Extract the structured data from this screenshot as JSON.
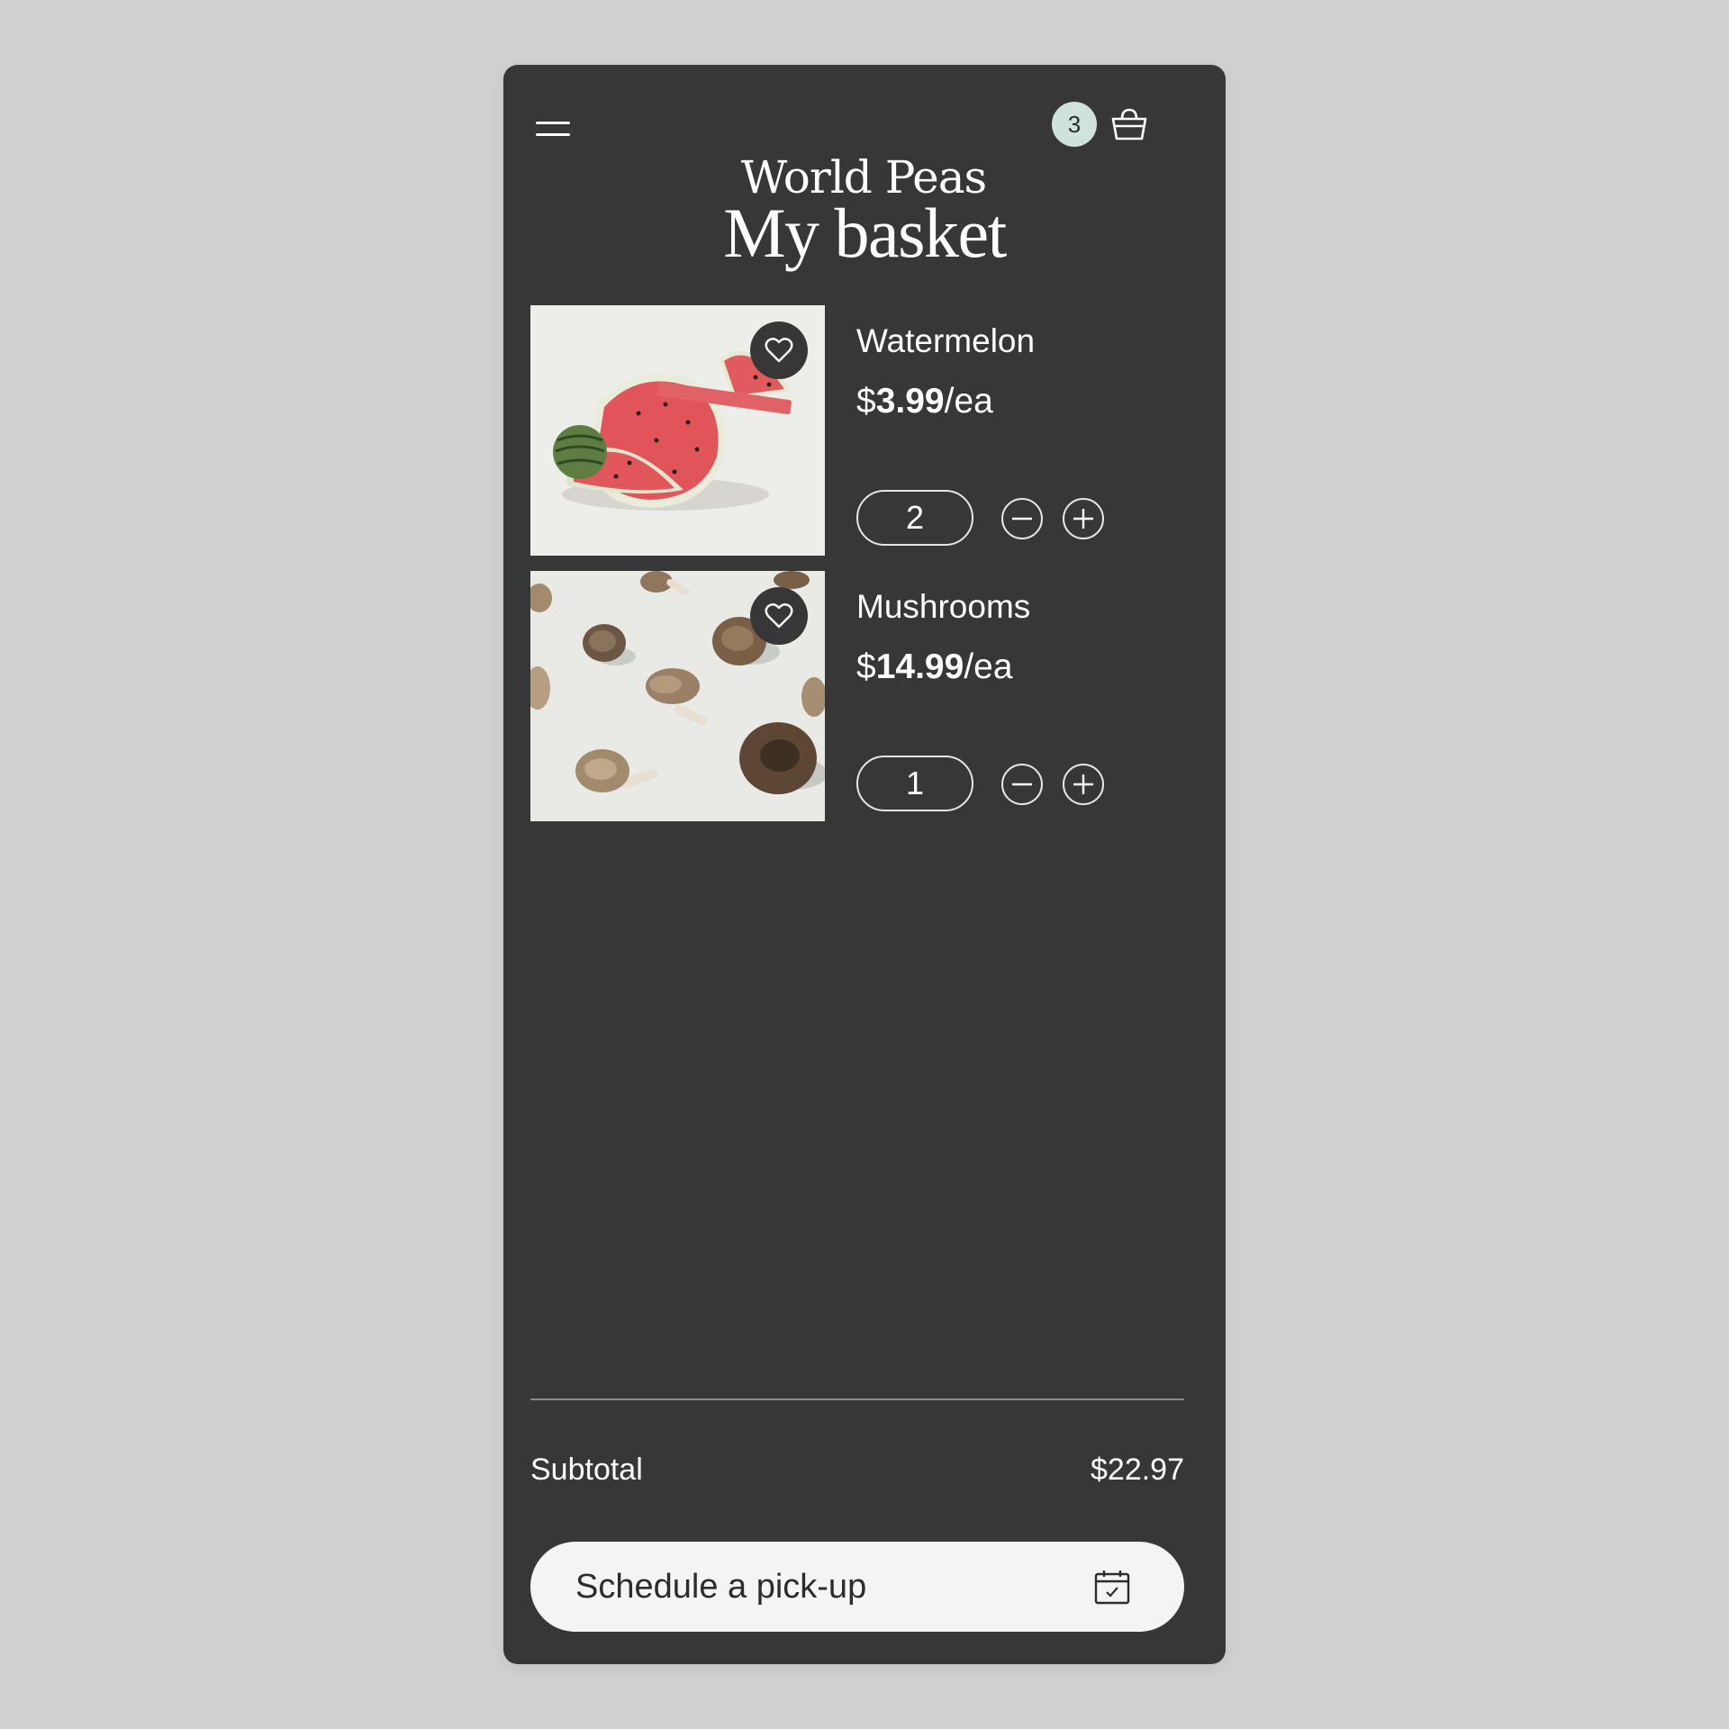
{
  "header": {
    "brand": "World Peas",
    "cart_count": "3",
    "menu_icon": "hamburger-icon",
    "cart_icon": "basket-icon"
  },
  "page": {
    "title": "My basket"
  },
  "items": [
    {
      "name": "Watermelon",
      "price_symbol": "$",
      "price_value": "3.99",
      "price_unit": "/ea",
      "quantity": "2"
    },
    {
      "name": "Mushrooms",
      "price_symbol": "$",
      "price_value": "14.99",
      "price_unit": "/ea",
      "quantity": "1"
    }
  ],
  "summary": {
    "subtotal_label": "Subtotal",
    "subtotal_value": "$22.97"
  },
  "cta": {
    "label": "Schedule a pick-up",
    "icon": "calendar-check-icon"
  },
  "colors": {
    "panel": "#373737",
    "page_background": "#d1d1d1",
    "badge": "#cfe3dc",
    "button": "#f4f4f4"
  }
}
